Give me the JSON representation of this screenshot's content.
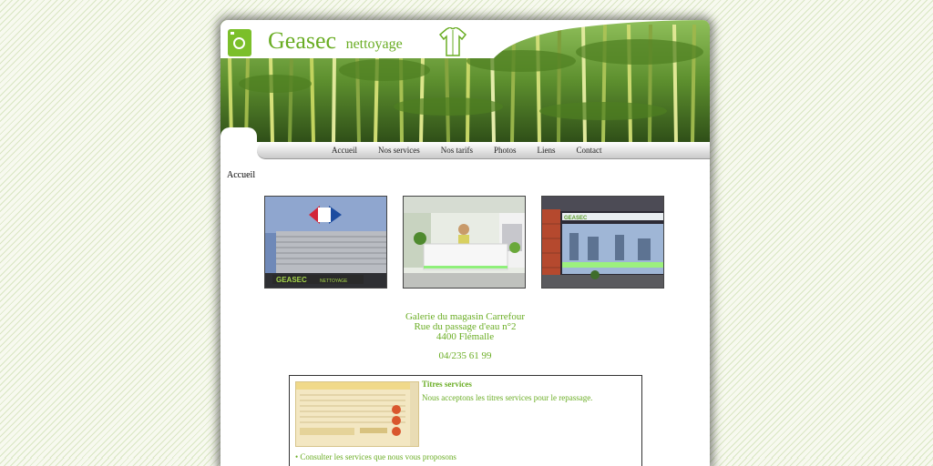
{
  "site": {
    "brand_name": "Geasec",
    "brand_sub": "nettoyage",
    "accent_color": "#6aad24"
  },
  "nav": {
    "items": [
      {
        "label": "Accueil"
      },
      {
        "label": "Nos services"
      },
      {
        "label": "Nos tarifs"
      },
      {
        "label": "Photos"
      },
      {
        "label": "Liens"
      },
      {
        "label": "Contact"
      }
    ]
  },
  "page": {
    "breadcrumb": "Accueil"
  },
  "photos": {
    "sign_text": "GEASEC",
    "sign_sub": "NETTOYAGE"
  },
  "address": {
    "line1": "Galerie du magasin Carrefour",
    "line2": "Rue du passage d'eau n°2",
    "line3": "4400 Flémalle",
    "phone": "04/235 61 99"
  },
  "services_box": {
    "title": "Titres services",
    "text": "Nous acceptons les titres services pour le repassage.",
    "link": "• Consulter les services que nous vous proposons"
  }
}
